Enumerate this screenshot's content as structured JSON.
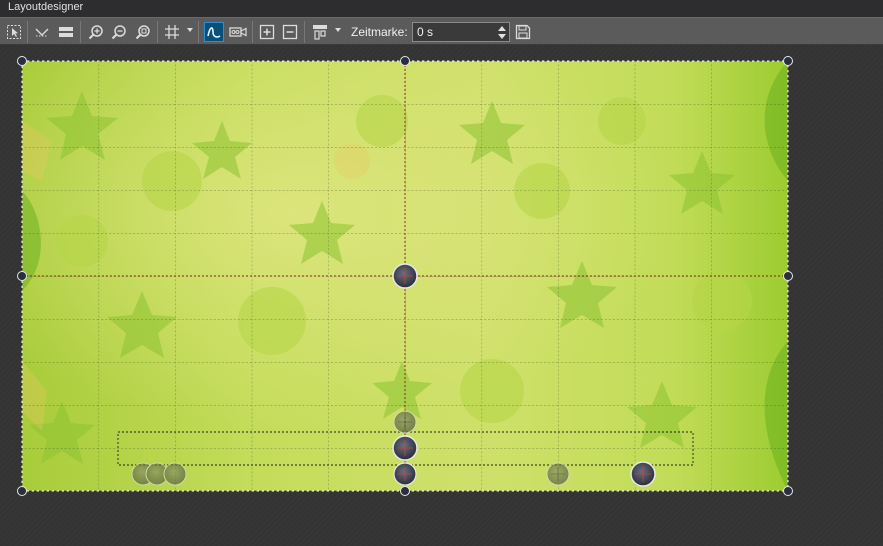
{
  "window": {
    "title": "Layoutdesigner"
  },
  "toolbar": {
    "buttons": [
      {
        "name": "select-all-icon"
      },
      {
        "name": "snap-guides-icon"
      },
      {
        "name": "layers-icon"
      },
      {
        "name": "zoom-in-icon"
      },
      {
        "name": "zoom-out-icon"
      },
      {
        "name": "zoom-fit-icon"
      },
      {
        "name": "grid-icon"
      },
      {
        "name": "motion-path-icon",
        "active": true
      },
      {
        "name": "camera-icon"
      },
      {
        "name": "add-keyframe-icon"
      },
      {
        "name": "remove-keyframe-icon"
      },
      {
        "name": "align-icon"
      },
      {
        "name": "save-icon"
      }
    ],
    "timestamp_label": "Zeitmarke:",
    "timestamp_value": "0 s"
  },
  "canvas": {
    "background": "green leaf pattern",
    "colors": {
      "accent": "#2e8ed0",
      "center_guide": "#8b1e1e",
      "grid_line": "#2a4a1a",
      "handle_fill": "#2a2f3e"
    }
  }
}
